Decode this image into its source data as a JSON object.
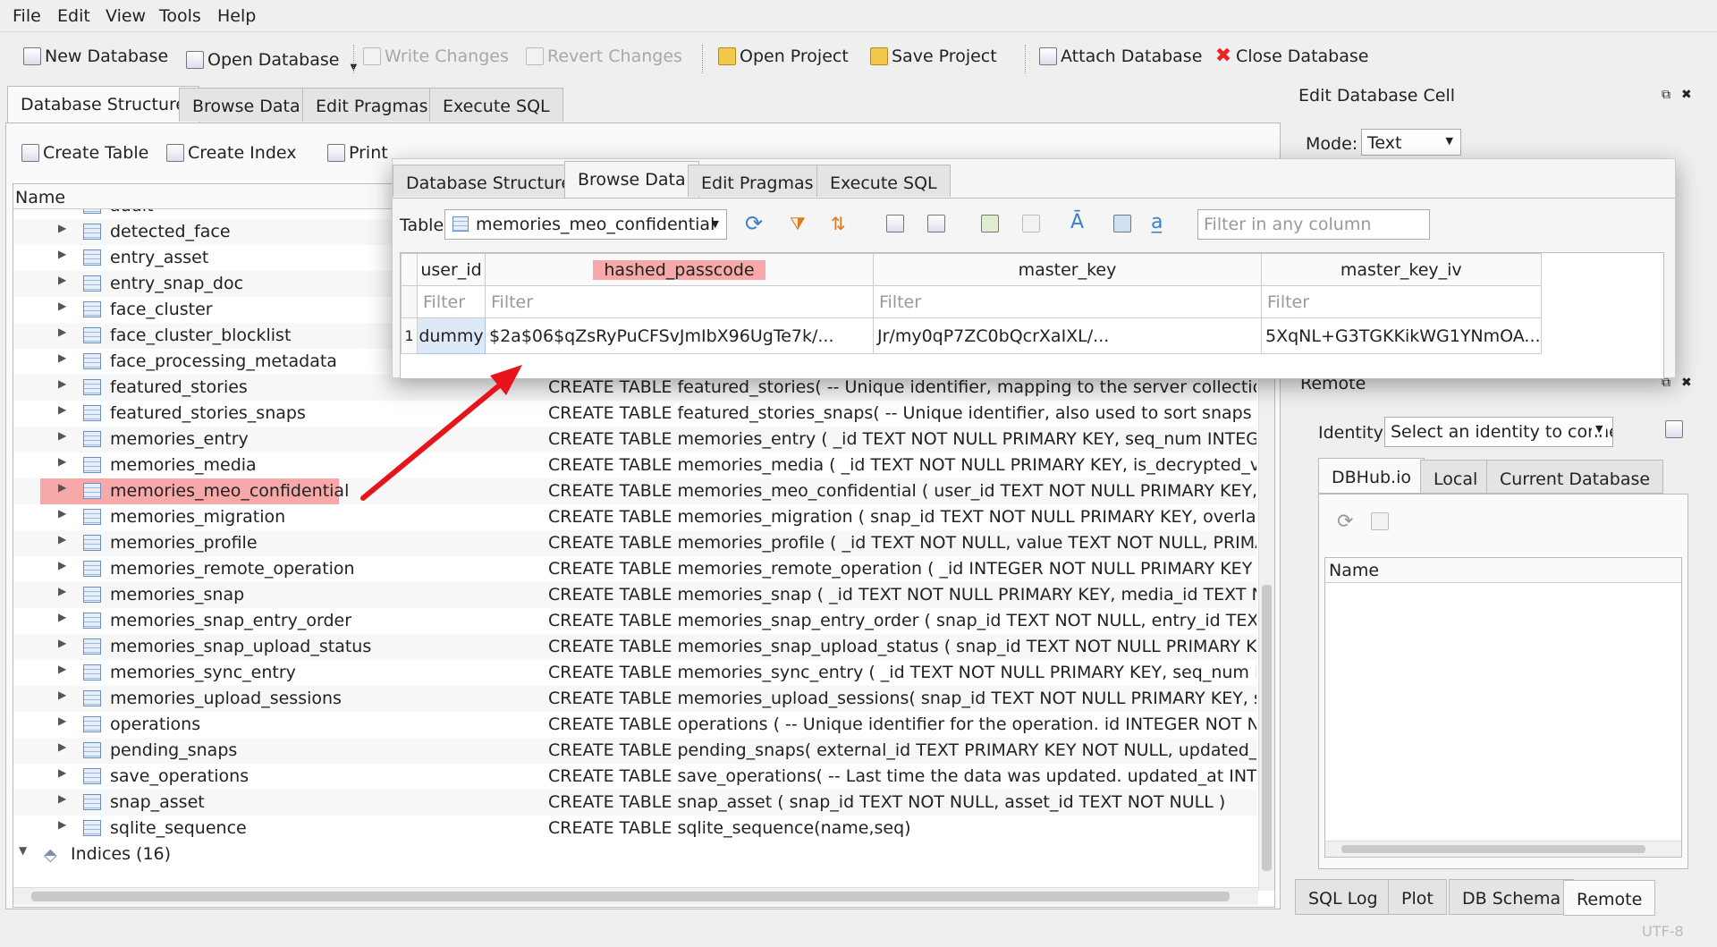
{
  "menu": [
    "File",
    "Edit",
    "View",
    "Tools",
    "Help"
  ],
  "toolbar": {
    "new_db": "New Database",
    "open_db": "Open Database",
    "write": "Write Changes",
    "revert": "Revert Changes",
    "open_project": "Open Project",
    "save_project": "Save Project",
    "attach": "Attach Database",
    "close": "Close Database"
  },
  "main_tabs": [
    "Database Structure",
    "Browse Data",
    "Edit Pragmas",
    "Execute SQL"
  ],
  "structure_toolbar": {
    "create_table": "Create Table",
    "create_index": "Create Index",
    "print": "Print"
  },
  "tree": {
    "col_name": "Name",
    "tables": [
      {
        "name": "audit",
        "schema": ""
      },
      {
        "name": "detected_face",
        "schema": ""
      },
      {
        "name": "entry_asset",
        "schema": ""
      },
      {
        "name": "entry_snap_doc",
        "schema": ""
      },
      {
        "name": "face_cluster",
        "schema": ""
      },
      {
        "name": "face_cluster_blocklist",
        "schema": ""
      },
      {
        "name": "face_processing_metadata",
        "schema": ""
      },
      {
        "name": "featured_stories",
        "schema": "CREATE TABLE featured_stories( -- Unique identifier, mapping to the server collection ID. id T"
      },
      {
        "name": "featured_stories_snaps",
        "schema": "CREATE TABLE featured_stories_snaps( -- Unique identifier, also used to sort snaps in a story."
      },
      {
        "name": "memories_entry",
        "schema": "CREATE TABLE memories_entry ( _id TEXT NOT NULL PRIMARY KEY, seq_num INTEGER NOT N"
      },
      {
        "name": "memories_media",
        "schema": "CREATE TABLE memories_media ( _id TEXT NOT NULL PRIMARY KEY, is_decrypted_video INTE"
      },
      {
        "name": "memories_meo_confidential",
        "schema": "CREATE TABLE memories_meo_confidential ( user_id TEXT NOT NULL PRIMARY KEY, hashed_"
      },
      {
        "name": "memories_migration",
        "schema": "CREATE TABLE memories_migration ( snap_id TEXT NOT NULL PRIMARY KEY, overlay_blob_m"
      },
      {
        "name": "memories_profile",
        "schema": "CREATE TABLE memories_profile ( _id TEXT NOT NULL, value TEXT NOT NULL, PRIMARY KEY ("
      },
      {
        "name": "memories_remote_operation",
        "schema": "CREATE TABLE memories_remote_operation ( _id INTEGER NOT NULL PRIMARY KEY AUTOINC"
      },
      {
        "name": "memories_snap",
        "schema": "CREATE TABLE memories_snap ( _id TEXT NOT NULL PRIMARY KEY, media_id TEXT NOT NULL"
      },
      {
        "name": "memories_snap_entry_order",
        "schema": "CREATE TABLE memories_snap_entry_order ( snap_id TEXT NOT NULL, entry_id TEXT NOT NU"
      },
      {
        "name": "memories_snap_upload_status",
        "schema": "CREATE TABLE memories_snap_upload_status ( snap_id TEXT NOT NULL PRIMARY KEY, uploa"
      },
      {
        "name": "memories_sync_entry",
        "schema": "CREATE TABLE memories_sync_entry ( _id TEXT NOT NULL PRIMARY KEY, seq_num INTEGER I"
      },
      {
        "name": "memories_upload_sessions",
        "schema": "CREATE TABLE memories_upload_sessions( snap_id TEXT NOT NULL PRIMARY KEY, session_i"
      },
      {
        "name": "operations",
        "schema": "CREATE TABLE operations ( -- Unique identifier for the operation. id INTEGER NOT NULL PRIM"
      },
      {
        "name": "pending_snaps",
        "schema": "CREATE TABLE pending_snaps( external_id TEXT PRIMARY KEY NOT NULL, updated_at INTEG"
      },
      {
        "name": "save_operations",
        "schema": "CREATE TABLE save_operations( -- Last time the data was updated. updated_at INTEGER NOT"
      },
      {
        "name": "snap_asset",
        "schema": "CREATE TABLE snap_asset ( snap_id TEXT NOT NULL, asset_id TEXT NOT NULL )"
      },
      {
        "name": "sqlite_sequence",
        "schema": "CREATE TABLE sqlite_sequence(name,seq)"
      }
    ],
    "indices": "Indices (16)"
  },
  "overlay": {
    "tabs": [
      "Database Structure",
      "Browse Data",
      "Edit Pragmas",
      "Execute SQL"
    ],
    "table_label": "Table:",
    "table_value": "memories_meo_confidential",
    "filter_placeholder": "Filter in any column",
    "columns": [
      "user_id",
      "hashed_passcode",
      "master_key",
      "master_key_iv"
    ],
    "filter": "Filter",
    "row_num": "1",
    "row": [
      "dummy",
      "$2a$06$qZsRyPuCFSvJmIbX96UgTe7k/...",
      "Jr/my0qP7ZC0bQcrXaIXL/...",
      "5XqNL+G3TGKKikWG1YNmOA..."
    ]
  },
  "edit_cell": {
    "title": "Edit Database Cell",
    "mode_label": "Mode:",
    "mode_value": "Text"
  },
  "remote": {
    "title": "Remote",
    "identity_label": "Identity",
    "identity_value": "Select an identity to connect",
    "tabs": [
      "DBHub.io",
      "Local",
      "Current Database"
    ],
    "col_name": "Name"
  },
  "bottom_tabs": [
    "SQL Log",
    "Plot",
    "DB Schema",
    "Remote"
  ],
  "status": "UTF-8",
  "colors": {
    "highlight": "#f7a9a9",
    "arrow": "#e8141b"
  }
}
